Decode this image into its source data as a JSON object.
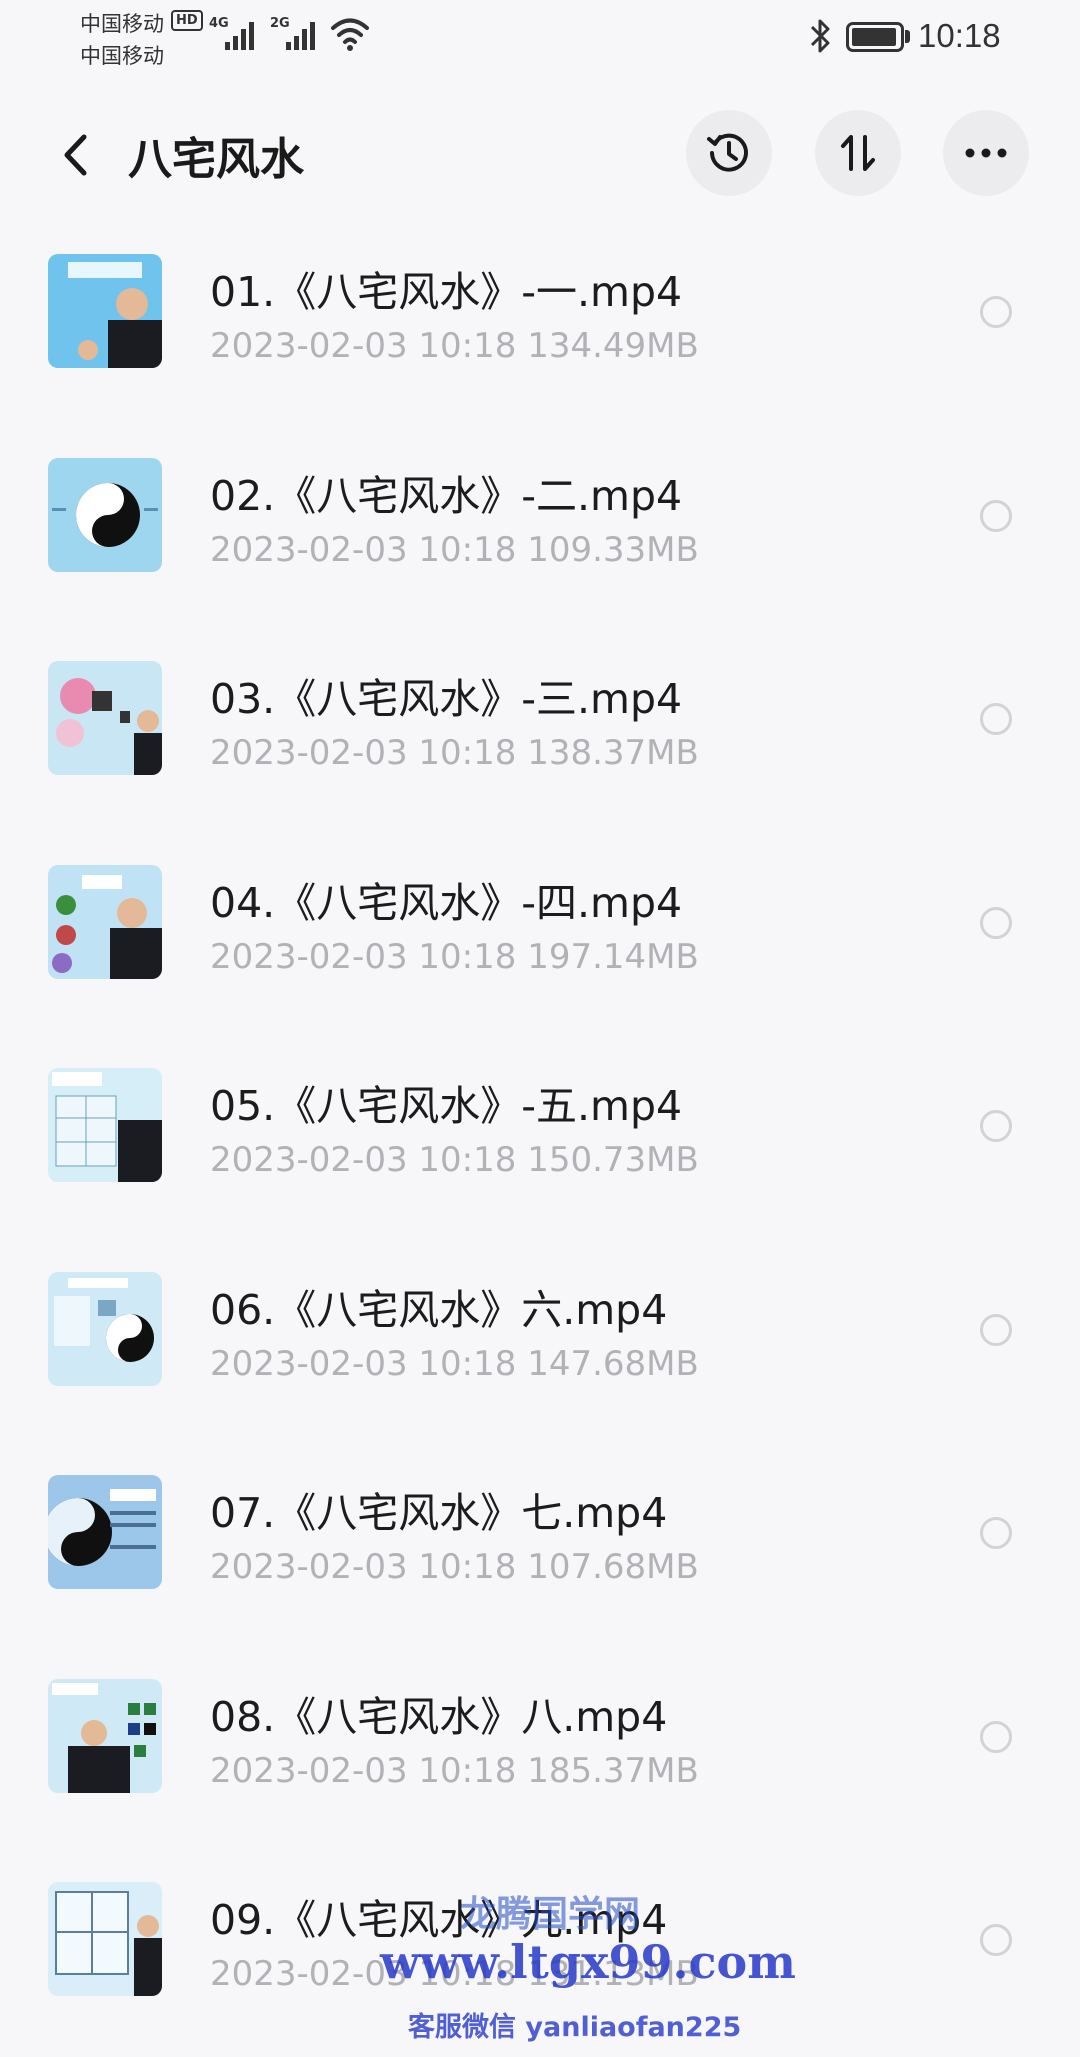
{
  "status_bar": {
    "carrier_1": "中国移动",
    "carrier_2": "中国移动",
    "hd_badge": "HD",
    "network_1": "4G",
    "network_2": "2G",
    "time": "10:18",
    "battery_level": 0.95
  },
  "header": {
    "title": "八宅风水",
    "icons": [
      "back-icon",
      "history-icon",
      "sort-icon",
      "more-icon"
    ]
  },
  "files": [
    {
      "name": "01.《八宅风水》-一.mp4",
      "meta": "2023-02-03  10:18  134.49MB"
    },
    {
      "name": "02.《八宅风水》-二.mp4",
      "meta": "2023-02-03  10:18  109.33MB"
    },
    {
      "name": "03.《八宅风水》-三.mp4",
      "meta": "2023-02-03  10:18  138.37MB"
    },
    {
      "name": "04.《八宅风水》-四.mp4",
      "meta": "2023-02-03  10:18  197.14MB"
    },
    {
      "name": "05.《八宅风水》-五.mp4",
      "meta": "2023-02-03  10:18  150.73MB"
    },
    {
      "name": "06.《八宅风水》六.mp4",
      "meta": "2023-02-03  10:18  147.68MB"
    },
    {
      "name": "07.《八宅风水》七.mp4",
      "meta": "2023-02-03  10:18  107.68MB"
    },
    {
      "name": "08.《八宅风水》八.mp4",
      "meta": "2023-02-03  10:18  185.37MB"
    },
    {
      "name": "09.《八宅风水》九.mp4",
      "meta": "2023-02-03  10:18  131.13MB"
    }
  ],
  "watermark": {
    "line1": "龙腾国学网",
    "line2": "www.ltgx99.com",
    "line3": "客服微信 yanliaofan225"
  },
  "colors": {
    "background": "#f7f7f9",
    "meta_text": "#b2b2b6",
    "button_bg": "#ececef",
    "watermark": "#2638c8"
  }
}
